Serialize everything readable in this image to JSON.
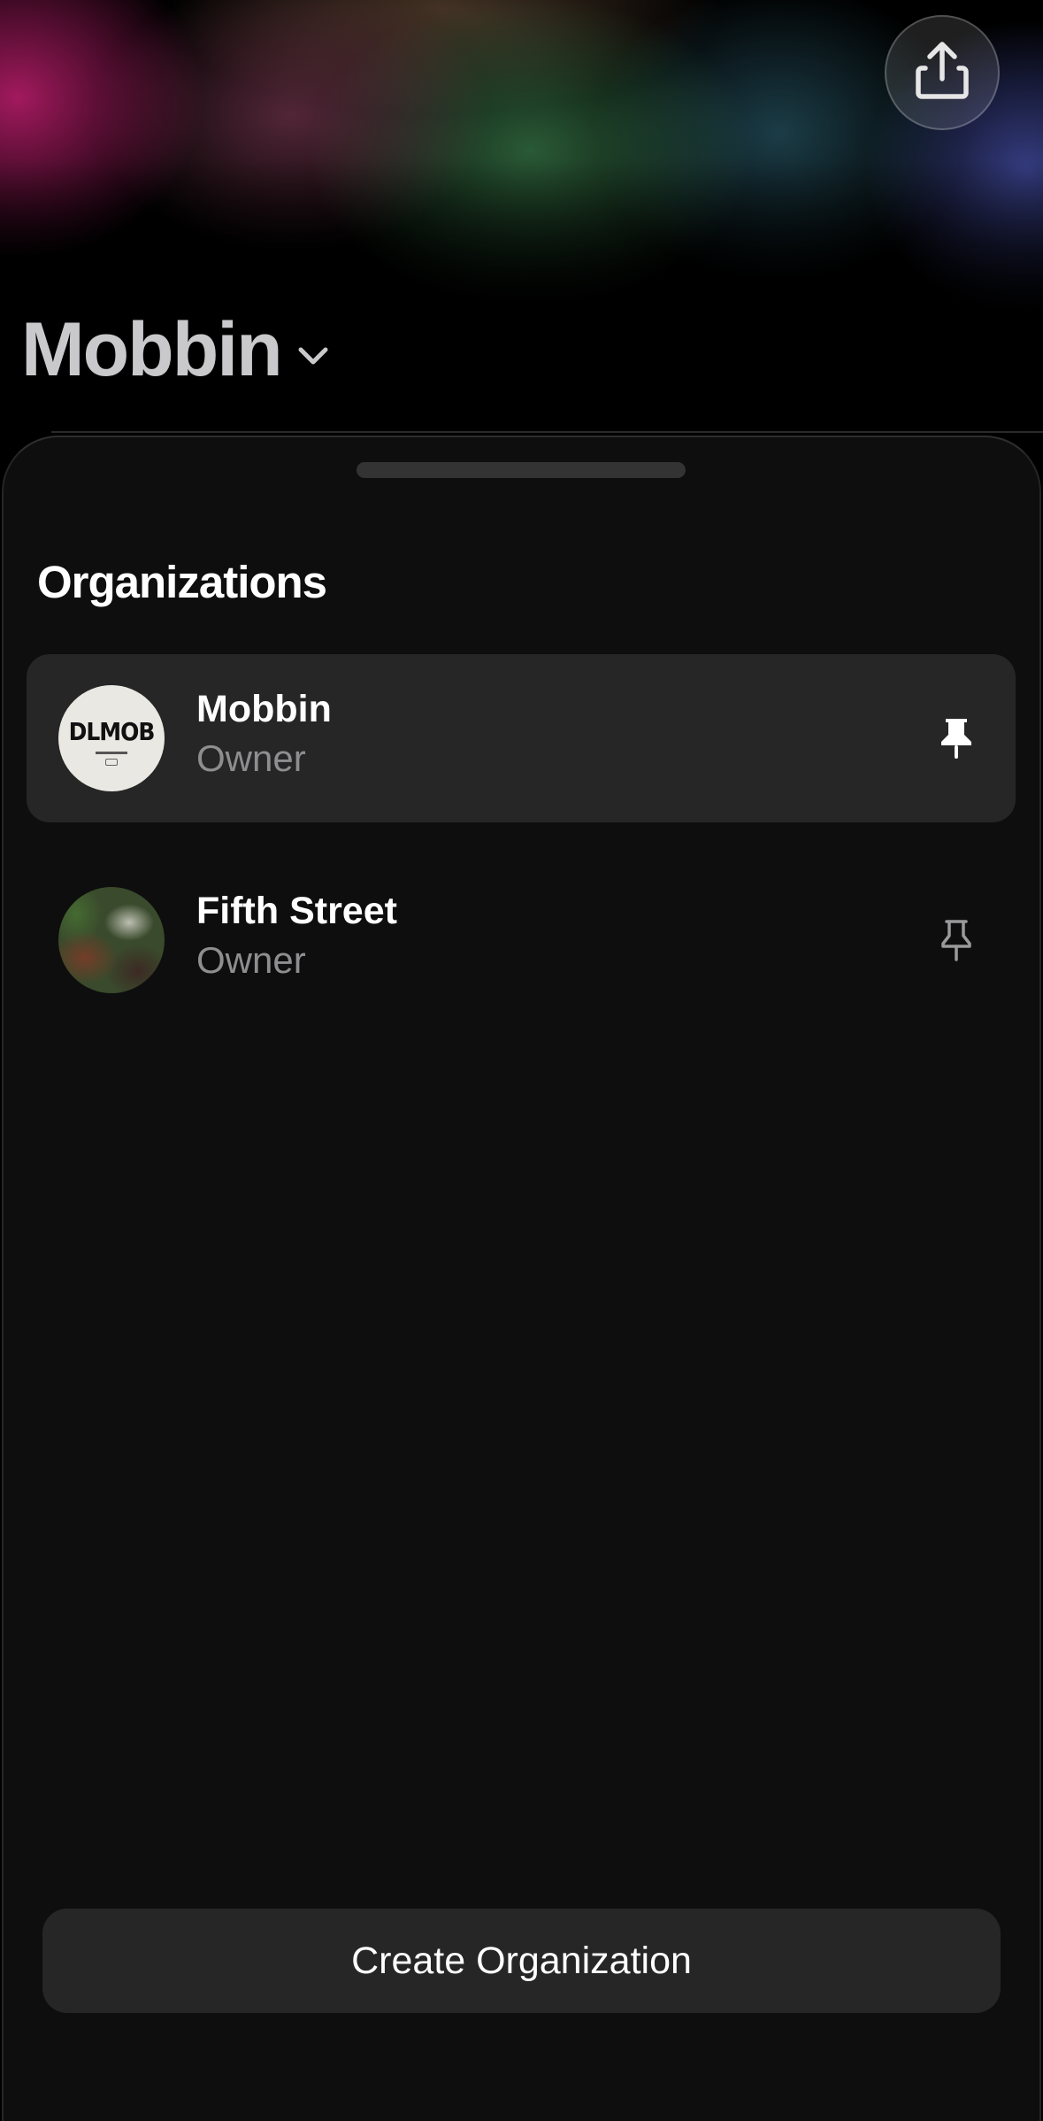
{
  "header": {
    "title": "Mobbin",
    "chevron_icon": "chevron-down-icon",
    "share_icon": "share-icon"
  },
  "sheet": {
    "section_title": "Organizations",
    "organizations": [
      {
        "name": "Mobbin",
        "role": "Owner",
        "avatar_text": "DLMOB",
        "selected": true,
        "pinned": true,
        "pin_icon": "pin-filled-icon"
      },
      {
        "name": "Fifth Street",
        "role": "Owner",
        "selected": false,
        "pinned": false,
        "pin_icon": "pin-outline-icon"
      }
    ],
    "create_button_label": "Create Organization"
  },
  "colors": {
    "sheet_background": "#0e0e0e",
    "selected_row": "#262626",
    "secondary_text": "#8e8e90",
    "title_text": "#c9c9cb"
  }
}
